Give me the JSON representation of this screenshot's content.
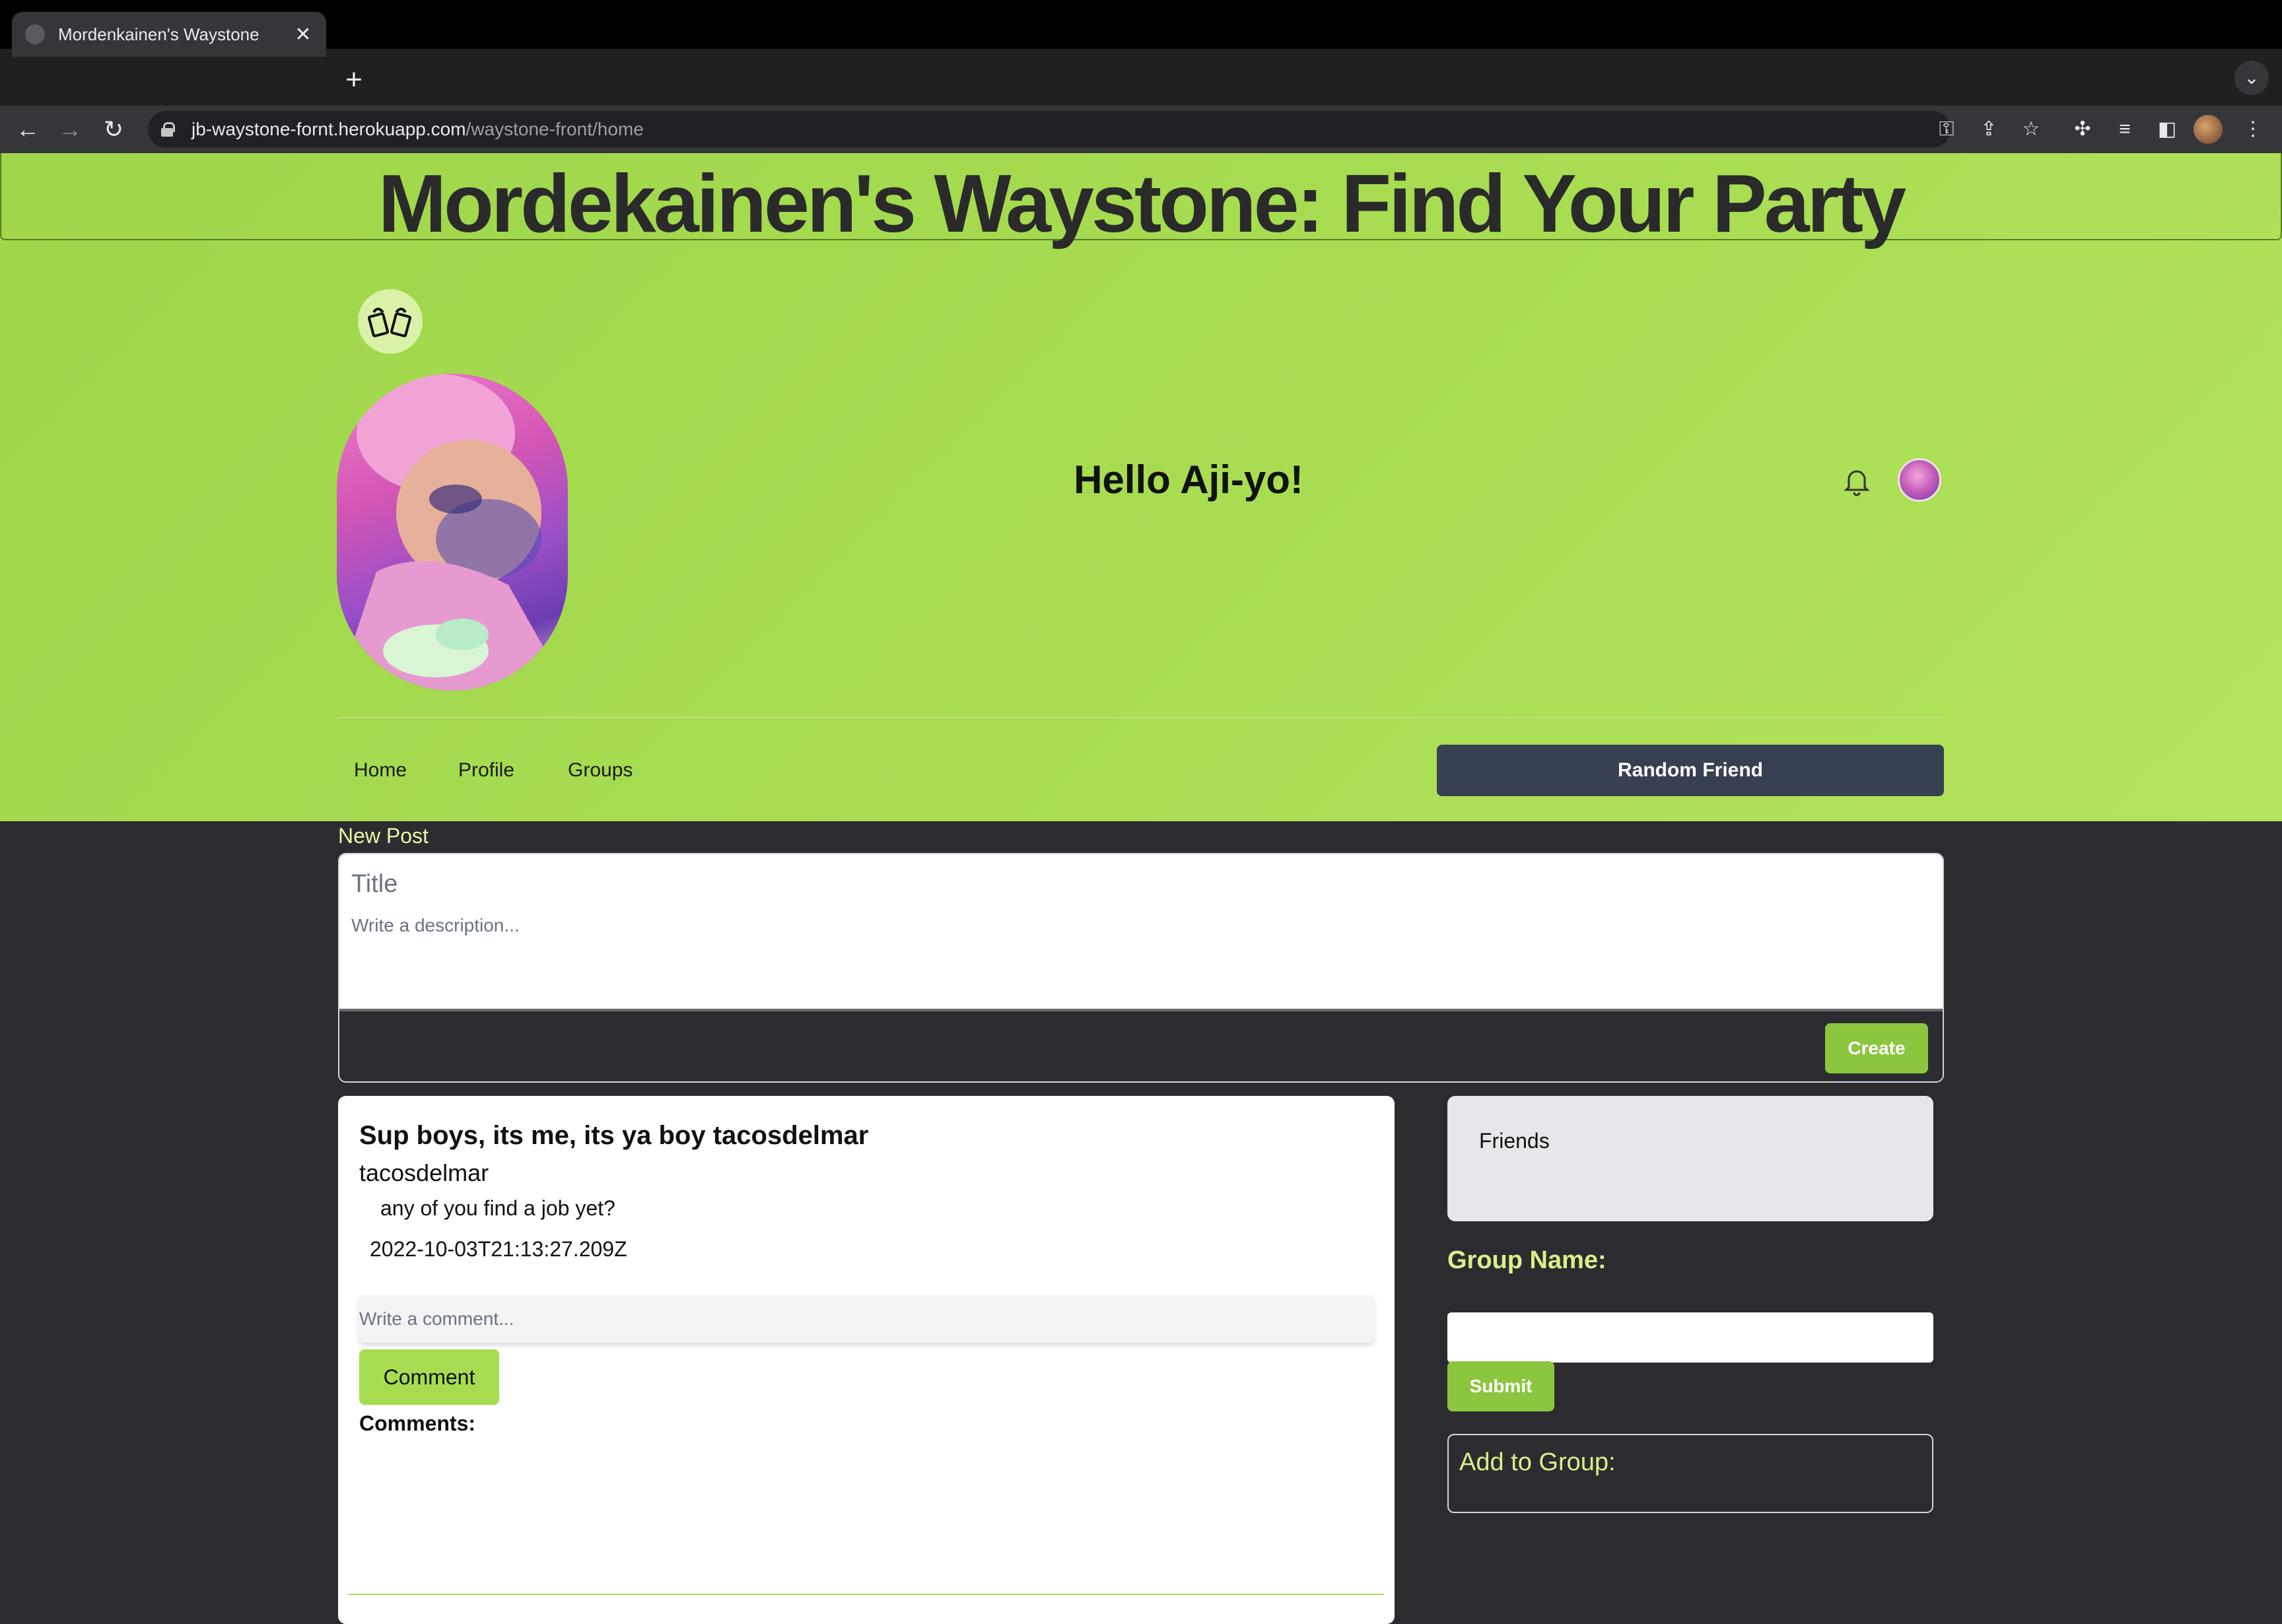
{
  "browser": {
    "tab_title": "Mordenkainen's Waystone",
    "tab_close": "✕",
    "new_tab": "+",
    "url_host": "jb-waystone-fornt.herokuapp.com",
    "url_path": "/waystone-front/home"
  },
  "header": {
    "site_title": "Mordekainen's Waystone: Find Your Party",
    "greeting": "Hello Aji-yo!"
  },
  "nav": {
    "home": "Home",
    "profile": "Profile",
    "groups": "Groups",
    "random_friend": "Random Friend"
  },
  "new_post": {
    "label": "New Post",
    "title_placeholder": "Title",
    "description_placeholder": "Write a description...",
    "create_label": "Create"
  },
  "post": {
    "title": "Sup boys, its me, its ya boy tacosdelmar",
    "author": "tacosdelmar",
    "body": "any of you find a job yet?",
    "date": "2022-10-03T21:13:27.209Z",
    "comment_placeholder": "Write a comment...",
    "comment_button": "Comment",
    "comments_label": "Comments:"
  },
  "sidebar": {
    "friends_label": "Friends",
    "group_name_label": "Group Name:",
    "submit_label": "Submit",
    "add_to_group_label": "Add to Group:"
  },
  "colors": {
    "hero_green": "#a8dd52",
    "dark_bg": "#2c2c30",
    "button_dark": "#374151",
    "accent_green": "#8cc63f"
  }
}
